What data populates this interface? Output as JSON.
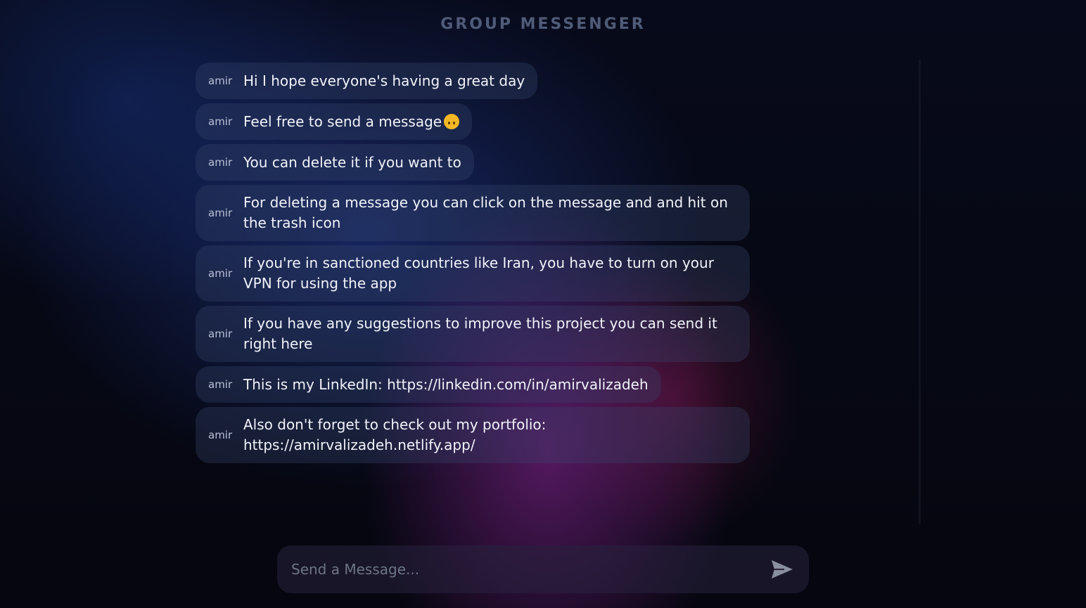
{
  "app": {
    "title": "GROUP  MESSENGER"
  },
  "messages": [
    {
      "sender": "amir",
      "text": "Hi I hope everyone's having a great day"
    },
    {
      "sender": "amir",
      "text": "Feel free to send a message",
      "emoji": "upside-down-face-emoji"
    },
    {
      "sender": "amir",
      "text": "You can delete it if you want to"
    },
    {
      "sender": "amir",
      "text": "For deleting a message you can click on the message and and hit on the trash icon"
    },
    {
      "sender": "amir",
      "text": "If you're in sanctioned countries like Iran, you have to turn on your VPN for using the app"
    },
    {
      "sender": "amir",
      "text": "If you have any suggestions to improve this project you can send it right here"
    },
    {
      "sender": "amir",
      "text": "This is my LinkedIn: https://linkedin.com/in/amirvalizadeh"
    },
    {
      "sender": "amir",
      "text": "Also don't forget to check out my portfolio: https://amirvalizadeh.netlify.app/"
    }
  ],
  "composer": {
    "placeholder": "Send a Message...",
    "value": "",
    "send_icon": "send-icon"
  },
  "colors": {
    "title": "#4f5b77",
    "bubble": "#2a3658",
    "send_icon": "#8a8f9f"
  }
}
